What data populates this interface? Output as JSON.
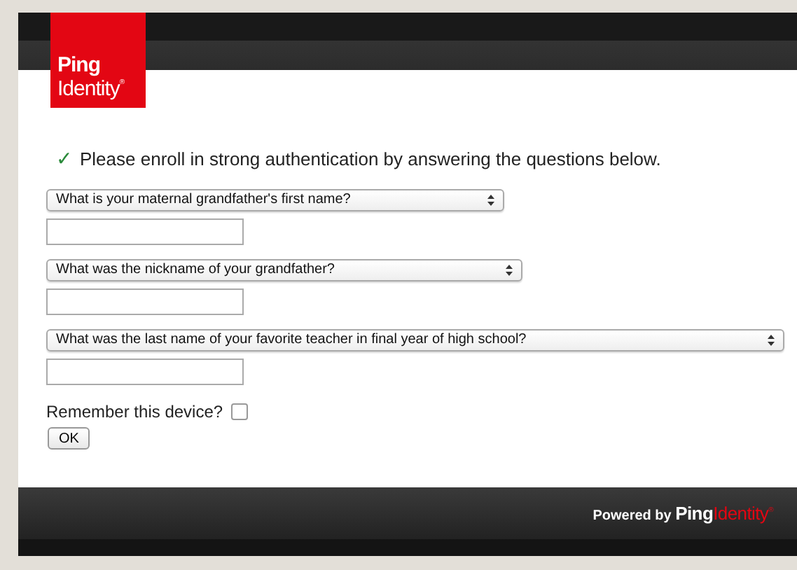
{
  "logo": {
    "line1": "Ping",
    "line2": "Identity",
    "mark": "®"
  },
  "message": {
    "text": "Please enroll in strong authentication by answering the questions below.",
    "checkmark": "✓"
  },
  "questions": [
    {
      "question": "What is your maternal grandfather's first name?"
    },
    {
      "question": "What was the nickname of your grandfather?"
    },
    {
      "question": "What was the last name of your favorite teacher in final year of high school?"
    }
  ],
  "remember": {
    "label": "Remember this device?",
    "checked": false
  },
  "buttons": [
    "OK"
  ],
  "footer": {
    "prefix": "Powered by",
    "brand1": "Ping",
    "brand2": "Identity",
    "mark": "®"
  }
}
